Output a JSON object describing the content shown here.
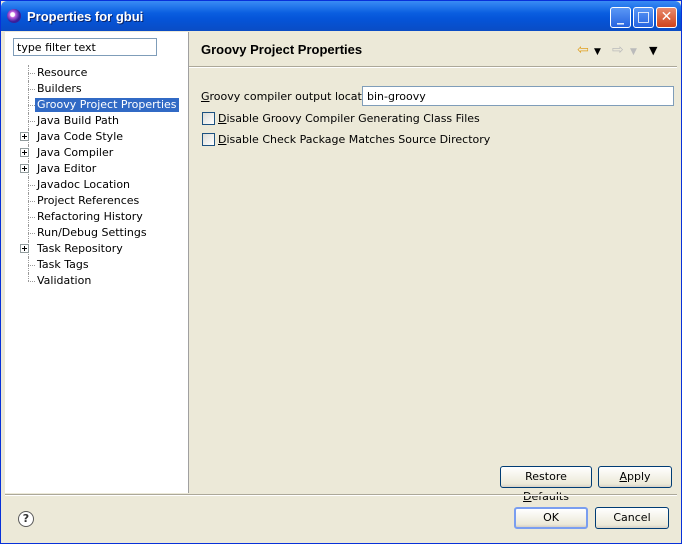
{
  "window": {
    "title": "Properties for gbui",
    "buttons": {
      "minimize": "_",
      "maximize": "□",
      "close": "✕"
    }
  },
  "sidebar": {
    "filter_placeholder": "type filter text",
    "filter_value": "type filter text",
    "items": [
      {
        "label": "Resource",
        "expandable": false,
        "selected": false
      },
      {
        "label": "Builders",
        "expandable": false,
        "selected": false
      },
      {
        "label": "Groovy Project Properties",
        "expandable": false,
        "selected": true
      },
      {
        "label": "Java Build Path",
        "expandable": false,
        "selected": false
      },
      {
        "label": "Java Code Style",
        "expandable": true,
        "selected": false
      },
      {
        "label": "Java Compiler",
        "expandable": true,
        "selected": false
      },
      {
        "label": "Java Editor",
        "expandable": true,
        "selected": false
      },
      {
        "label": "Javadoc Location",
        "expandable": false,
        "selected": false
      },
      {
        "label": "Project References",
        "expandable": false,
        "selected": false
      },
      {
        "label": "Refactoring History",
        "expandable": false,
        "selected": false
      },
      {
        "label": "Run/Debug Settings",
        "expandable": false,
        "selected": false
      },
      {
        "label": "Task Repository",
        "expandable": true,
        "selected": false
      },
      {
        "label": "Task Tags",
        "expandable": false,
        "selected": false
      },
      {
        "label": "Validation",
        "expandable": false,
        "selected": false
      }
    ]
  },
  "page": {
    "title": "Groovy Project Properties",
    "output_location": {
      "label_first": "G",
      "label_rest": "roovy compiler output location",
      "value": "bin-groovy"
    },
    "checkboxes": [
      {
        "mnemonic": "D",
        "rest": "isable Groovy Compiler Generating Class Files",
        "checked": false
      },
      {
        "mnemonic": "D",
        "rest": "isable Check Package Matches Source Directory",
        "checked": false
      }
    ],
    "restore_defaults": {
      "before": "Restore ",
      "mnemonic": "D",
      "after": "efaults"
    },
    "apply": {
      "mnemonic": "A",
      "after": "pply"
    }
  },
  "footer": {
    "help_icon": "?",
    "ok_label": "OK",
    "cancel_label": "Cancel"
  },
  "icons": {
    "back": "back-arrow-icon",
    "forward": "forward-arrow-icon",
    "menu": "view-menu-icon",
    "app": "eclipse-icon",
    "help": "help-icon"
  },
  "colors": {
    "titlebar": "#0554d8",
    "selection": "#316ac5",
    "dialog_bg": "#ece9d8"
  }
}
